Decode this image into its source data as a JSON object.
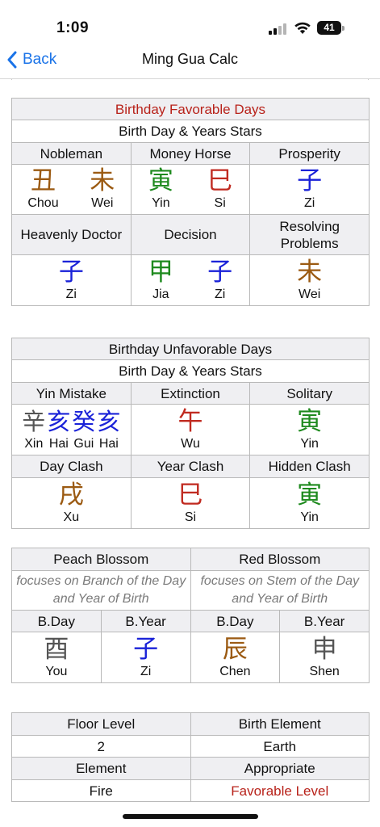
{
  "status": {
    "time": "1:09",
    "battery": "41"
  },
  "nav": {
    "back_label": "Back",
    "title": "Ming Gua Calc"
  },
  "favorable": {
    "title": "Birthday Favorable Days",
    "subtitle": "Birth Day & Years Stars",
    "row1_headers": [
      "Nobleman",
      "Money Horse",
      "Prosperity"
    ],
    "row1_values": [
      [
        {
          "ch": "丑",
          "py": "Chou",
          "color": "#9b5a12"
        },
        {
          "ch": "未",
          "py": "Wei",
          "color": "#9b5a12"
        }
      ],
      [
        {
          "ch": "寅",
          "py": "Yin",
          "color": "#1e8a1e"
        },
        {
          "ch": "巳",
          "py": "Si",
          "color": "#c02a20"
        }
      ],
      [
        {
          "ch": "子",
          "py": "Zi",
          "color": "#1a22d8"
        }
      ]
    ],
    "row2_headers": [
      "Heavenly Doctor",
      "Decision",
      "Resolving Problems"
    ],
    "row2_values": [
      [
        {
          "ch": "子",
          "py": "Zi",
          "color": "#1a22d8"
        }
      ],
      [
        {
          "ch": "甲",
          "py": "Jia",
          "color": "#1e8a1e"
        },
        {
          "ch": "子",
          "py": "Zi",
          "color": "#1a22d8"
        }
      ],
      [
        {
          "ch": "未",
          "py": "Wei",
          "color": "#9b5a12"
        }
      ]
    ]
  },
  "unfavorable": {
    "title": "Birthday Unfavorable Days",
    "subtitle": "Birth Day & Years Stars",
    "row1_headers": [
      "Yin Mistake",
      "Extinction",
      "Solitary"
    ],
    "row1_values": [
      [
        {
          "ch": "辛",
          "py": "Xin",
          "color": "#555555"
        },
        {
          "ch": "亥",
          "py": "Hai",
          "color": "#1a22d8"
        },
        {
          "ch": "癸",
          "py": "Gui",
          "color": "#1a22d8"
        },
        {
          "ch": "亥",
          "py": "Hai",
          "color": "#1a22d8"
        }
      ],
      [
        {
          "ch": "午",
          "py": "Wu",
          "color": "#c02a20"
        }
      ],
      [
        {
          "ch": "寅",
          "py": "Yin",
          "color": "#1e8a1e"
        }
      ]
    ],
    "row2_headers": [
      "Day Clash",
      "Year Clash",
      "Hidden Clash"
    ],
    "row2_values": [
      [
        {
          "ch": "戌",
          "py": "Xu",
          "color": "#9b5a12"
        }
      ],
      [
        {
          "ch": "巳",
          "py": "Si",
          "color": "#c02a20"
        }
      ],
      [
        {
          "ch": "寅",
          "py": "Yin",
          "color": "#1e8a1e"
        }
      ]
    ]
  },
  "blossom": {
    "headers": [
      "Peach Blossom",
      "Red Blossom"
    ],
    "notes": [
      "focuses on Branch of the Day and Year of Birth",
      "focuses on Stem of the Day and Year of Birth"
    ],
    "subheaders": [
      "B.Day",
      "B.Year",
      "B.Day",
      "B.Year"
    ],
    "values": [
      {
        "ch": "酉",
        "py": "You",
        "color": "#555555"
      },
      {
        "ch": "子",
        "py": "Zi",
        "color": "#1a22d8"
      },
      {
        "ch": "辰",
        "py": "Chen",
        "color": "#9b5a12"
      },
      {
        "ch": "申",
        "py": "Shen",
        "color": "#555555"
      }
    ]
  },
  "levels": {
    "headers1": [
      "Floor Level",
      "Birth Element"
    ],
    "values1": [
      "2",
      "Earth"
    ],
    "headers2": [
      "Element",
      "Appropriate"
    ],
    "values2": [
      "Fire",
      "Favorable Level"
    ],
    "appropriate_color": "#b8221a"
  }
}
